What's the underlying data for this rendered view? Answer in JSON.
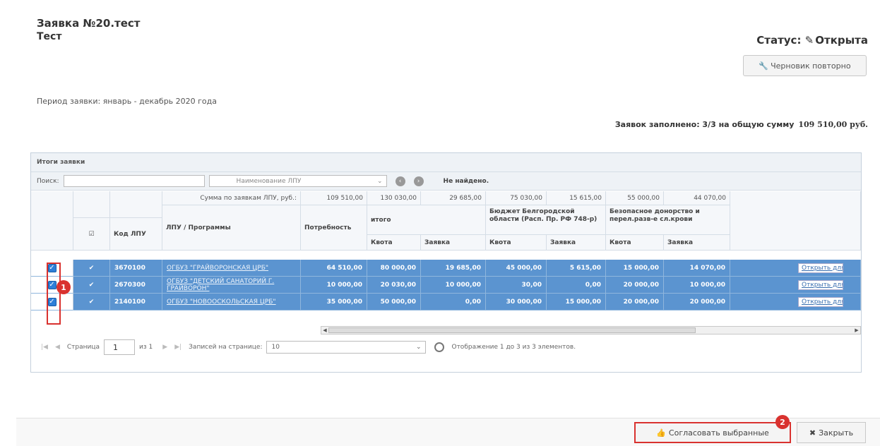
{
  "header": {
    "title_line1": "Заявка №20.тест",
    "title_line2": "Тест",
    "status_label": "Статус:",
    "status_value": "Открыта",
    "draft_button": "Черновик повторно",
    "period": "Период заявки: январь - декабрь 2020 года",
    "filled_label": "Заявок заполнено: 3/3 на общую сумму",
    "filled_sum": "109 510,00 руб."
  },
  "panel": {
    "title": "Итоги заявки",
    "search_label": "Поиск:",
    "search_value": "",
    "filter_select": "Наименование ЛПУ",
    "not_found": "Не найдено."
  },
  "table": {
    "sum_row_label": "Сумма по заявкам ЛПУ, руб.:",
    "sum_row_values": [
      "109 510,00",
      "130 030,00",
      "29 685,00",
      "75 030,00",
      "15 615,00",
      "55 000,00",
      "44 070,00"
    ],
    "col_code": "Код ЛПУ",
    "col_name": "ЛПУ / Программы",
    "col_need": "Потребность",
    "group_total": "итого",
    "group_budget": "Бюджет Белгородской области (Расп. Пр. РФ 748-р)",
    "group_donor": "Безопасное донорство и перел.разв-е сл.крови",
    "sub_quota": "Квота",
    "sub_request": "Заявка",
    "rows": [
      {
        "code": "3670100",
        "name": "ОГБУЗ \"ГРАЙВОРОНСКАЯ ЦРБ\"",
        "need": "64 510,00",
        "total_quota": "80 000,00",
        "total_request": "19 685,00",
        "budget_quota": "45 000,00",
        "budget_request": "5 615,00",
        "donor_quota": "15 000,00",
        "donor_request": "14 070,00",
        "action": "Открыть для р"
      },
      {
        "code": "2670300",
        "name": "ОГБУЗ \"ДЕТСКИЙ САНАТОРИЙ Г. ГРАЙВОРОН\"",
        "need": "10 000,00",
        "total_quota": "20 030,00",
        "total_request": "10 000,00",
        "budget_quota": "30,00",
        "budget_request": "0,00",
        "donor_quota": "20 000,00",
        "donor_request": "10 000,00",
        "action": "Открыть для р"
      },
      {
        "code": "2140100",
        "name": "ОГБУЗ \"НОВООСКОЛЬСКАЯ ЦРБ\"",
        "need": "35 000,00",
        "total_quota": "50 000,00",
        "total_request": "0,00",
        "budget_quota": "30 000,00",
        "budget_request": "15 000,00",
        "donor_quota": "20 000,00",
        "donor_request": "20 000,00",
        "action": "Открыть для р"
      }
    ]
  },
  "pager": {
    "page_label": "Страница",
    "page_value": "1",
    "of_label": "из 1",
    "per_page_label": "Записей на странице:",
    "per_page_value": "10",
    "display_info": "Отображение 1 до 3 из 3 элементов."
  },
  "footer": {
    "approve_button": "Согласовать выбранные",
    "close_button": "Закрыть"
  },
  "markers": {
    "first": "1",
    "second": "2"
  },
  "colors": {
    "selected_row": "#5b94d0",
    "marker": "#d9322f"
  }
}
